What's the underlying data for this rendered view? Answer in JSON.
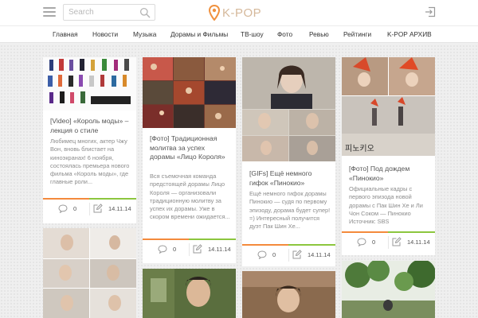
{
  "header": {
    "menu_icon": "hamburger-icon",
    "search_placeholder": "Search",
    "search_icon": "search-icon",
    "logo_icon": "map-pin-icon",
    "logo_text": "K-POP",
    "login_icon": "sign-in-icon",
    "accent_color": "#f0913e"
  },
  "nav": {
    "items": [
      "Главная",
      "Новости",
      "Музыка",
      "Дорамы и Фильмы",
      "ТВ-шоу",
      "Фото",
      "Ревью",
      "Рейтинги",
      "K-POP АРХИВ"
    ]
  },
  "cards": [
    {
      "title": "[Video] «Король моды» – лекция о стиле",
      "excerpt": "Любимец многих, актер Чжу Вон, вновь блистает на киноэкранах! 6 ноября, состоялась премьера нового фильма «Король моды», где главные роли...",
      "comments": "0",
      "date": "14.11.14"
    },
    {
      "title": "[Фото] Традиционная молитва за успех дорамы «Лицо Короля»",
      "excerpt": "Вся съемочная команда предстоящей дорамы Лицо Короля — организовали традиционную молитву за успех их дорамы. Уже в скором времени ожидается...",
      "comments": "0",
      "date": "14.11.14"
    },
    {
      "title": "[GIFs] Ещё немного гифок «Пинокио»",
      "excerpt": "Ещё немного гифок дорамы Пинокио — судя по первому эпизоду, дорама будет супер! =) Интересный получится дуэт Пак Шин Хе...",
      "comments": "0",
      "date": "14.11.14"
    },
    {
      "title": "[Фото] Под дождем «Пинокио»",
      "excerpt": "Официальные кадры с первого эпизода новой дорамы с Пак Шин Хе и Ли Чон Соком — Пинокио Источник: SBS",
      "comments": "0",
      "date": "14.11.14"
    }
  ],
  "footer_icons": {
    "comment": "comment-icon",
    "date": "edit-icon"
  },
  "bar_colors": {
    "left": "#f48a3c",
    "right": "#8cc63e"
  },
  "image_texts": {
    "still_caption": "피노키오"
  }
}
